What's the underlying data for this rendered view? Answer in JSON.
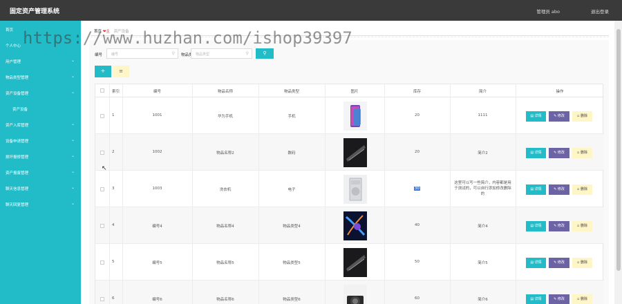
{
  "header": {
    "title": "固定资产管理系统",
    "user": "管理员 abo",
    "logout": "退出登录"
  },
  "sidebar": {
    "items": [
      {
        "label": "首页",
        "chevron": false
      },
      {
        "label": "个人中心",
        "chevron": false
      },
      {
        "label": "用户管理",
        "chevron": true
      },
      {
        "label": "物品类型管理",
        "chevron": true
      },
      {
        "label": "资产设备管理",
        "chevron": true
      },
      {
        "label": "资产设备",
        "chevron": false,
        "sub": true
      },
      {
        "label": "资产入库管理",
        "chevron": true
      },
      {
        "label": "设备申请管理",
        "chevron": true
      },
      {
        "label": "损坏报修管理",
        "chevron": true
      },
      {
        "label": "资产报废管理",
        "chevron": true
      },
      {
        "label": "聊天信息管理",
        "chevron": true
      },
      {
        "label": "聊天回复管理",
        "chevron": true
      }
    ]
  },
  "breadcrumb": {
    "home": "首页",
    "heart": "❤",
    "label": "主",
    "current": "资产设备"
  },
  "watermark": "https://www.huzhan.com/ishop39397",
  "filters": {
    "code_label": "编号",
    "code_placeholder": "编号",
    "type_label": "物品类型",
    "type_placeholder": "物品类型",
    "search_icon": "search-icon"
  },
  "toolbar": {
    "add": "+",
    "batch_delete": "≡"
  },
  "table": {
    "headers": [
      "",
      "索引",
      "编号",
      "物品名称",
      "物品类型",
      "图片",
      "库存",
      "简介",
      "操作"
    ],
    "rows": [
      {
        "index": "1",
        "code": "1001",
        "name": "华为手机",
        "type": "手机",
        "stock": "20",
        "intro": "1111",
        "img": "phone"
      },
      {
        "index": "2",
        "code": "1002",
        "name": "物品名称2",
        "type": "数码",
        "stock": "20",
        "intro": "简介2",
        "img": "dark"
      },
      {
        "index": "3",
        "code": "1003",
        "name": "洗衣机",
        "type": "电子",
        "stock": "30",
        "intro": "这里可以写一些简介，内容都是用于测试的，可以自行添加修改删除的",
        "img": "washer"
      },
      {
        "index": "4",
        "code": "编号4",
        "name": "物品名称4",
        "type": "物品类型4",
        "stock": "40",
        "intro": "简介4",
        "img": "neon"
      },
      {
        "index": "5",
        "code": "编号5",
        "name": "物品名称5",
        "type": "物品类型5",
        "stock": "50",
        "intro": "简介5",
        "img": "dark"
      },
      {
        "index": "6",
        "code": "编号6",
        "name": "物品名称6",
        "type": "物品类型6",
        "stock": "60",
        "intro": "简介6",
        "img": "camera"
      }
    ],
    "actions": {
      "detail": "详情",
      "edit": "修改",
      "delete": "删除"
    }
  },
  "colors": {
    "accent": "#22bcc8",
    "edit": "#6b63a4",
    "delete": "#fff6c8",
    "topbar": "#3a3a3a"
  }
}
